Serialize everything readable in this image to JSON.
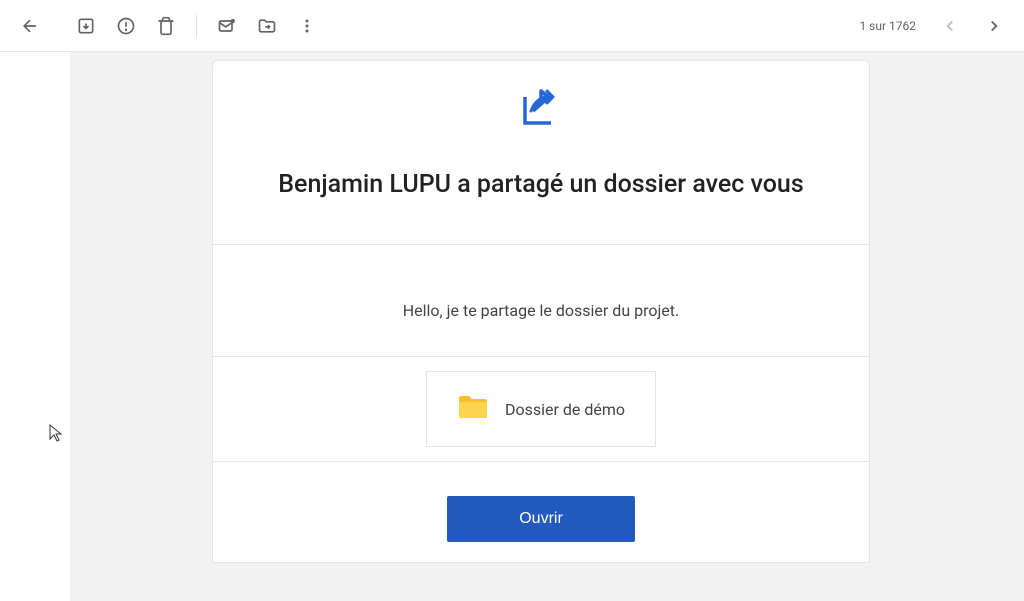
{
  "toolbar": {
    "page_counter": "1 sur 1762"
  },
  "email": {
    "title": "Benjamin LUPU a partagé un dossier avec vous",
    "body_text": "Hello, je te partage le dossier du projet.",
    "folder_name": "Dossier de démo",
    "open_button": "Ouvrir"
  }
}
